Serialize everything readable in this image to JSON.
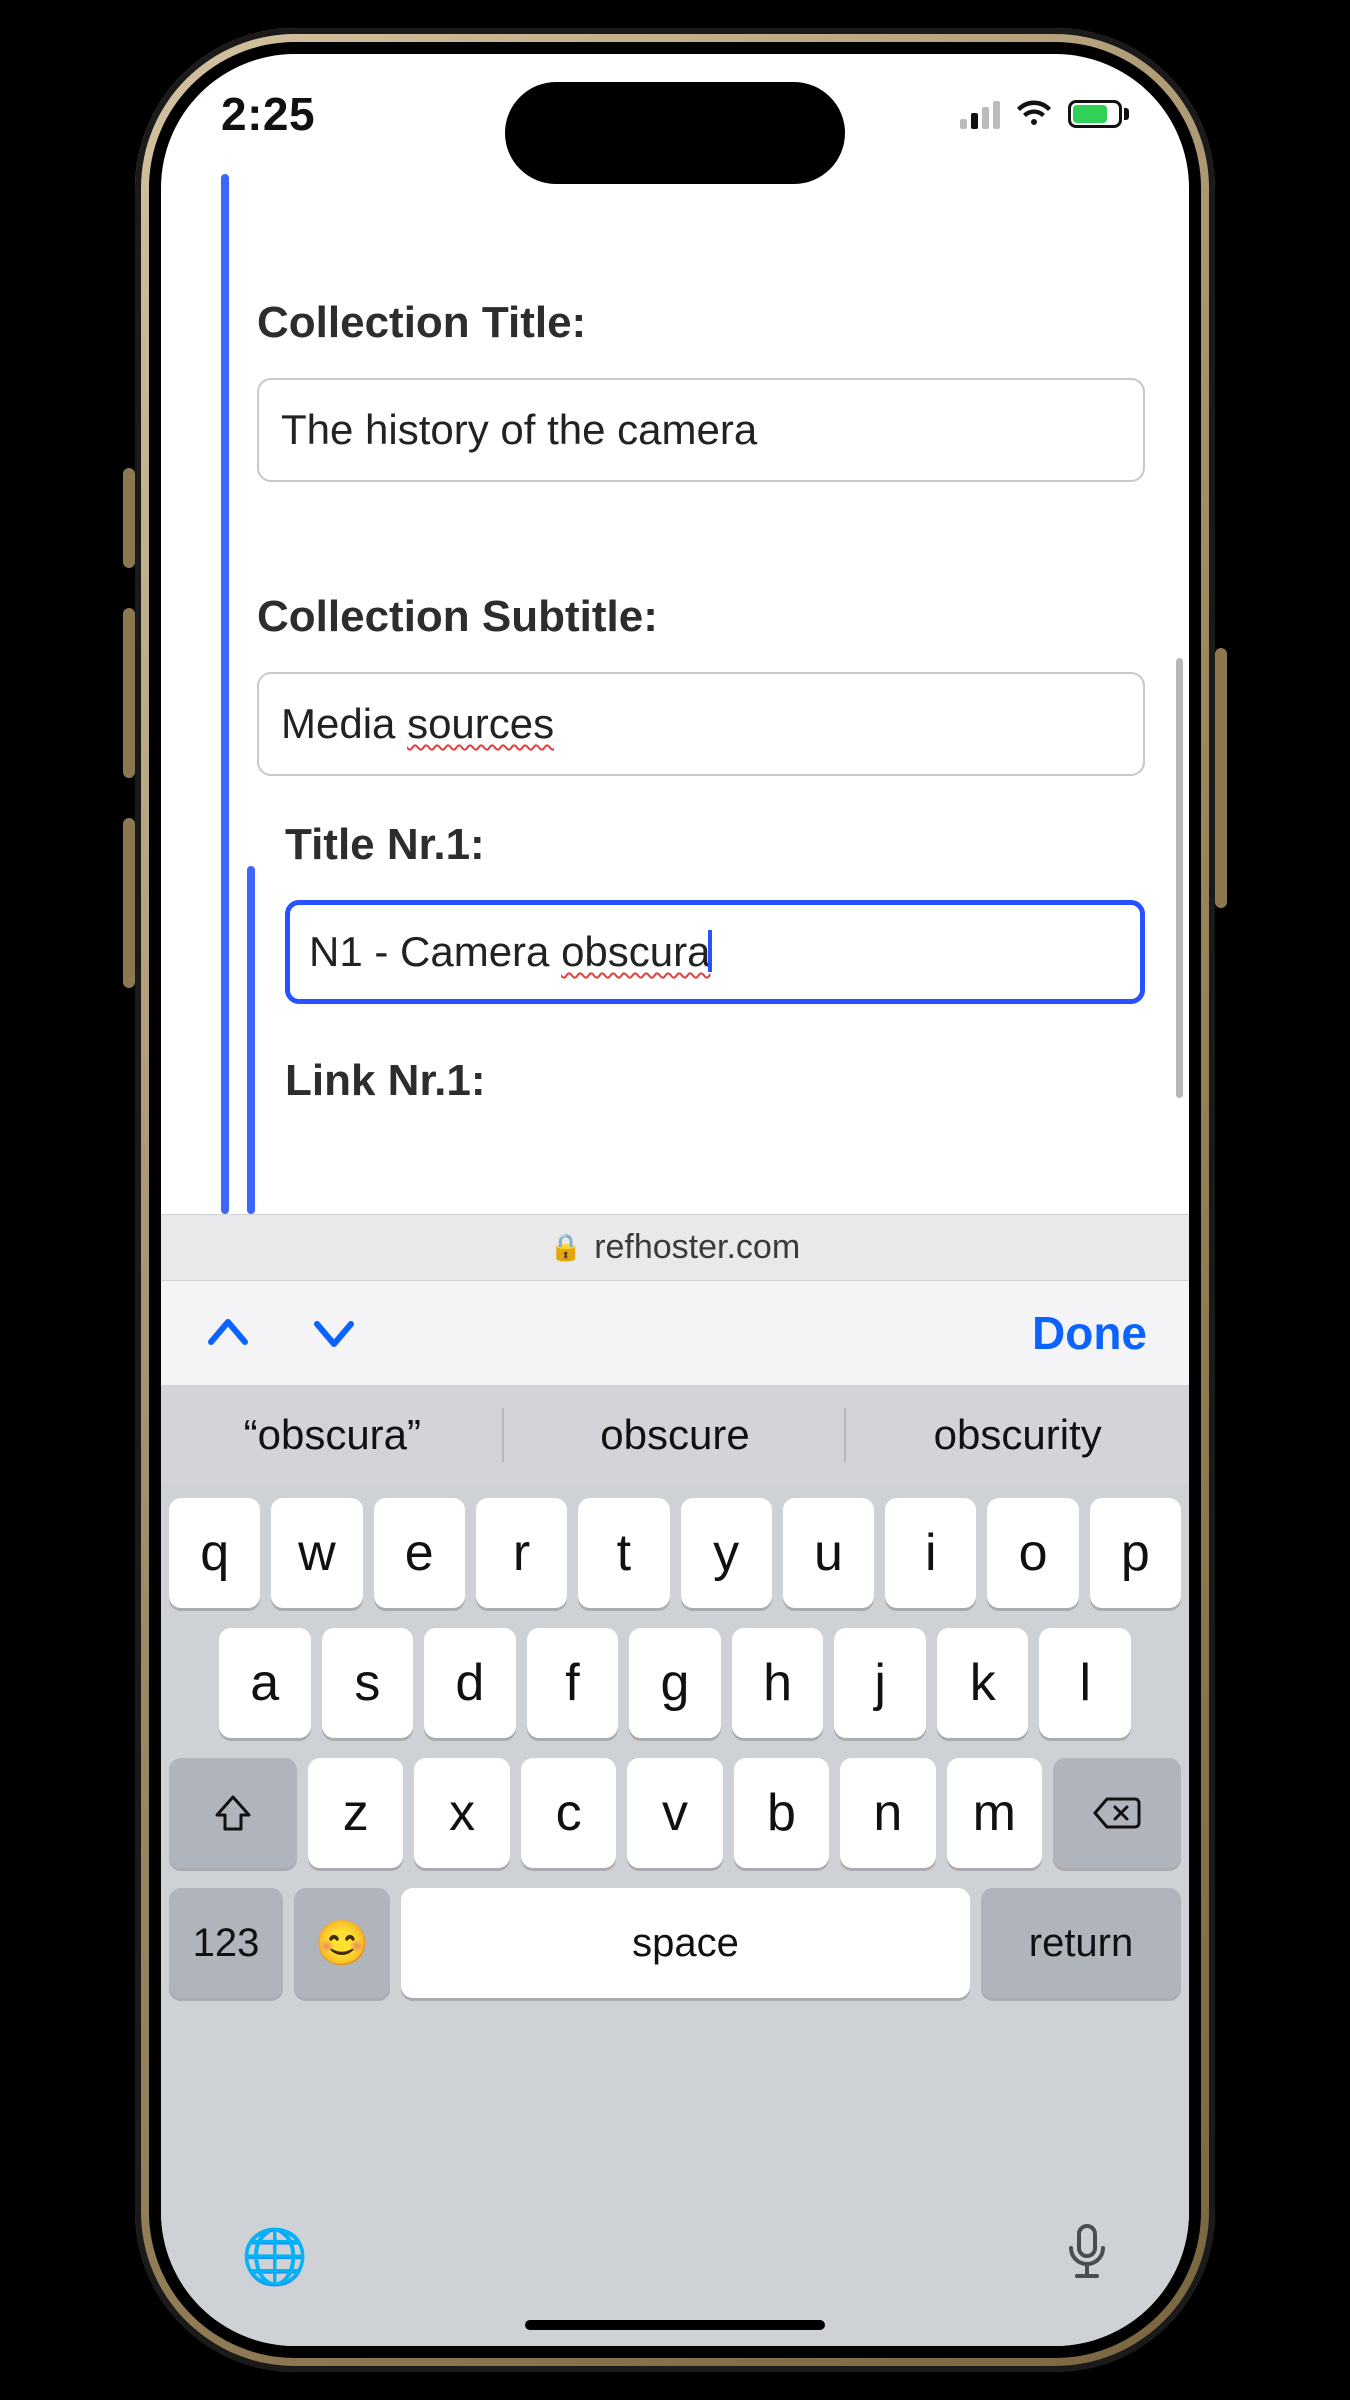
{
  "status": {
    "time": "2:25"
  },
  "address_bar": {
    "domain": "refhoster.com"
  },
  "form": {
    "collection_title_label": "Collection Title:",
    "collection_title_value": "The history of the camera",
    "collection_subtitle_label": "Collection Subtitle:",
    "collection_subtitle_value_plain": "Media ",
    "collection_subtitle_value_spell": "sources",
    "title1_label": "Title Nr.1:",
    "title1_value_plain": "N1 - Camera ",
    "title1_value_spell": "obscura",
    "link1_label": "Link Nr.1:"
  },
  "keyboard_accessory": {
    "done": "Done"
  },
  "suggestions": [
    "“obscura”",
    "obscure",
    "obscurity"
  ],
  "keyboard": {
    "row1": [
      "q",
      "w",
      "e",
      "r",
      "t",
      "y",
      "u",
      "i",
      "o",
      "p"
    ],
    "row2": [
      "a",
      "s",
      "d",
      "f",
      "g",
      "h",
      "j",
      "k",
      "l"
    ],
    "row3": [
      "z",
      "x",
      "c",
      "v",
      "b",
      "n",
      "m"
    ],
    "numkey": "123",
    "space": "space",
    "return": "return"
  }
}
